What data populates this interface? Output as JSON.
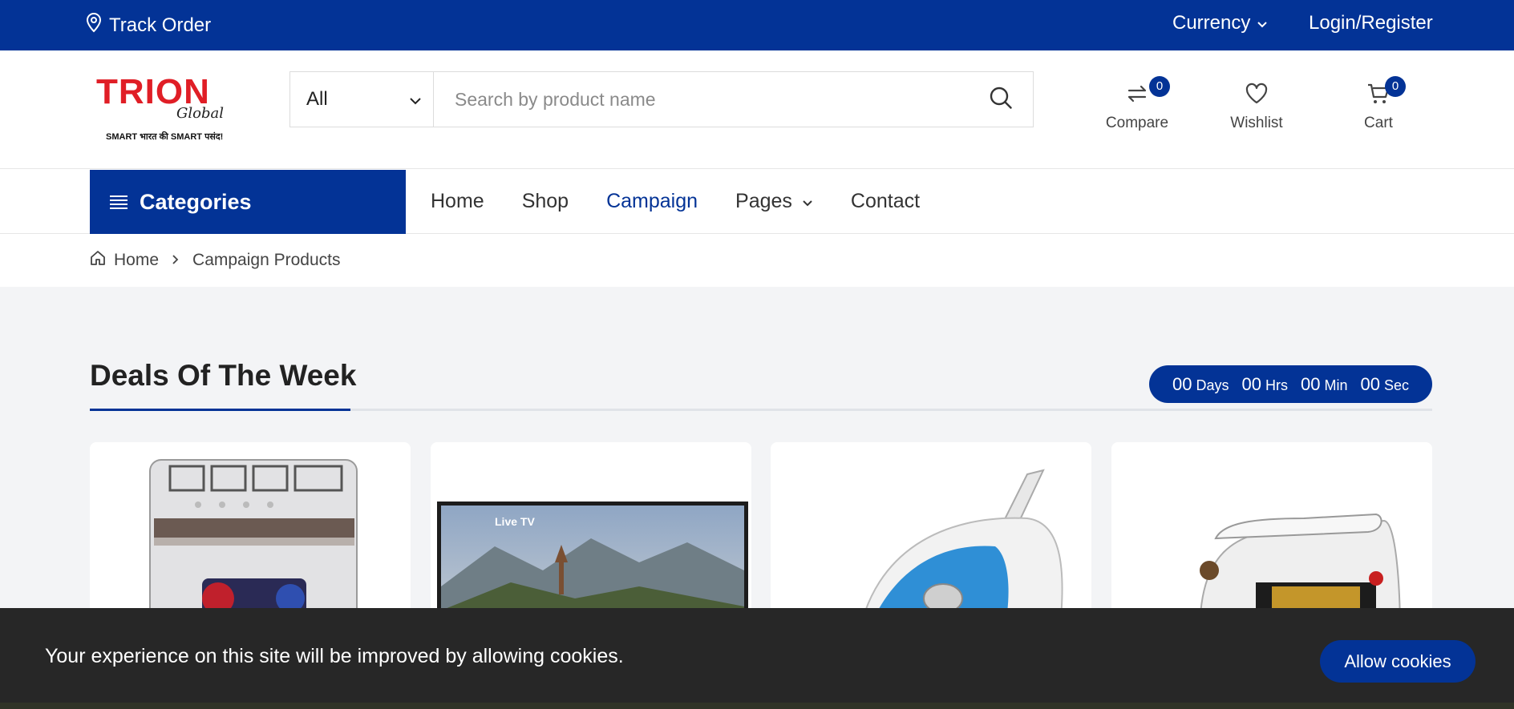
{
  "topbar": {
    "track_order": "Track Order",
    "currency": "Currency",
    "login_register": "Login/Register"
  },
  "logo": {
    "brand_text": "TRION",
    "sub_text": "Global",
    "tagline": "SMART भारत की SMART पसंद!"
  },
  "search": {
    "category_selected": "All",
    "placeholder": "Search by product name"
  },
  "header_actions": {
    "compare_label": "Compare",
    "compare_count": "0",
    "wishlist_label": "Wishlist",
    "cart_label": "Cart",
    "cart_count": "0"
  },
  "nav": {
    "categories_label": "Categories",
    "items": [
      "Home",
      "Shop",
      "Campaign",
      "Pages",
      "Contact"
    ],
    "active": "Campaign"
  },
  "breadcrumb": {
    "home": "Home",
    "current": "Campaign Products"
  },
  "deals": {
    "title": "Deals Of The Week",
    "countdown": {
      "days": "00",
      "days_label": "Days",
      "hrs": "00",
      "hrs_label": "Hrs",
      "min": "00",
      "min_label": "Min",
      "sec": "00",
      "sec_label": "Sec"
    },
    "products": [
      {
        "image": "washing-machine"
      },
      {
        "image": "led-tv",
        "screen_text": "Live TV"
      },
      {
        "image": "steam-iron-blue"
      },
      {
        "image": "dry-iron-white"
      }
    ]
  },
  "cookie": {
    "message": "Your experience on this site will be improved by allowing cookies.",
    "button": "Allow cookies"
  },
  "colors": {
    "brand_blue": "#033396",
    "logo_red": "#e01e26",
    "cookie_bg": "#272727",
    "page_bg": "#f3f4f6"
  }
}
